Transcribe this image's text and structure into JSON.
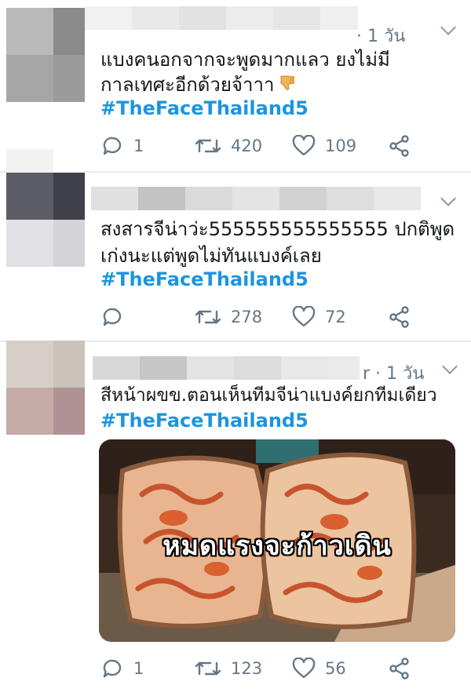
{
  "tweets": [
    {
      "time": "· 1 วัน",
      "text_lines": [
        "แบงคนอกจากจะพูดมากแลว ยงไม่มี",
        "กาลเทศะอีกด้วยจ้าาา"
      ],
      "hashtag": "#TheFaceThailand5",
      "reply_count": "1",
      "retweet_count": "420",
      "like_count": "109",
      "emoji": "thumbs-down"
    },
    {
      "time": "",
      "text_lines": [
        "สงสารจีน่าว่ะ555555555555555 ปกติพูด",
        "เก่งนะแต่พูดไม่ทันแบงค์เลย"
      ],
      "hashtag": "#TheFaceThailand5",
      "reply_count": "",
      "retweet_count": "278",
      "like_count": "72"
    },
    {
      "time": "r · 1 วัน",
      "text_lines": [
        "สีหน้าผขข.ตอนเห็นทีมจีน่าแบงค์ยกทีมเดียว"
      ],
      "hashtag": "#TheFaceThailand5",
      "media_caption": "หมดแรงจะก้าวเดิน",
      "reply_count": "1",
      "retweet_count": "123",
      "like_count": "56"
    }
  ],
  "colors": {
    "hashtag": "#1b95e0",
    "icon": "#657786",
    "divider": "#e6ecf0"
  },
  "icons": [
    "reply-icon",
    "retweet-icon",
    "like-icon",
    "share-icon",
    "chevron-down-icon"
  ]
}
